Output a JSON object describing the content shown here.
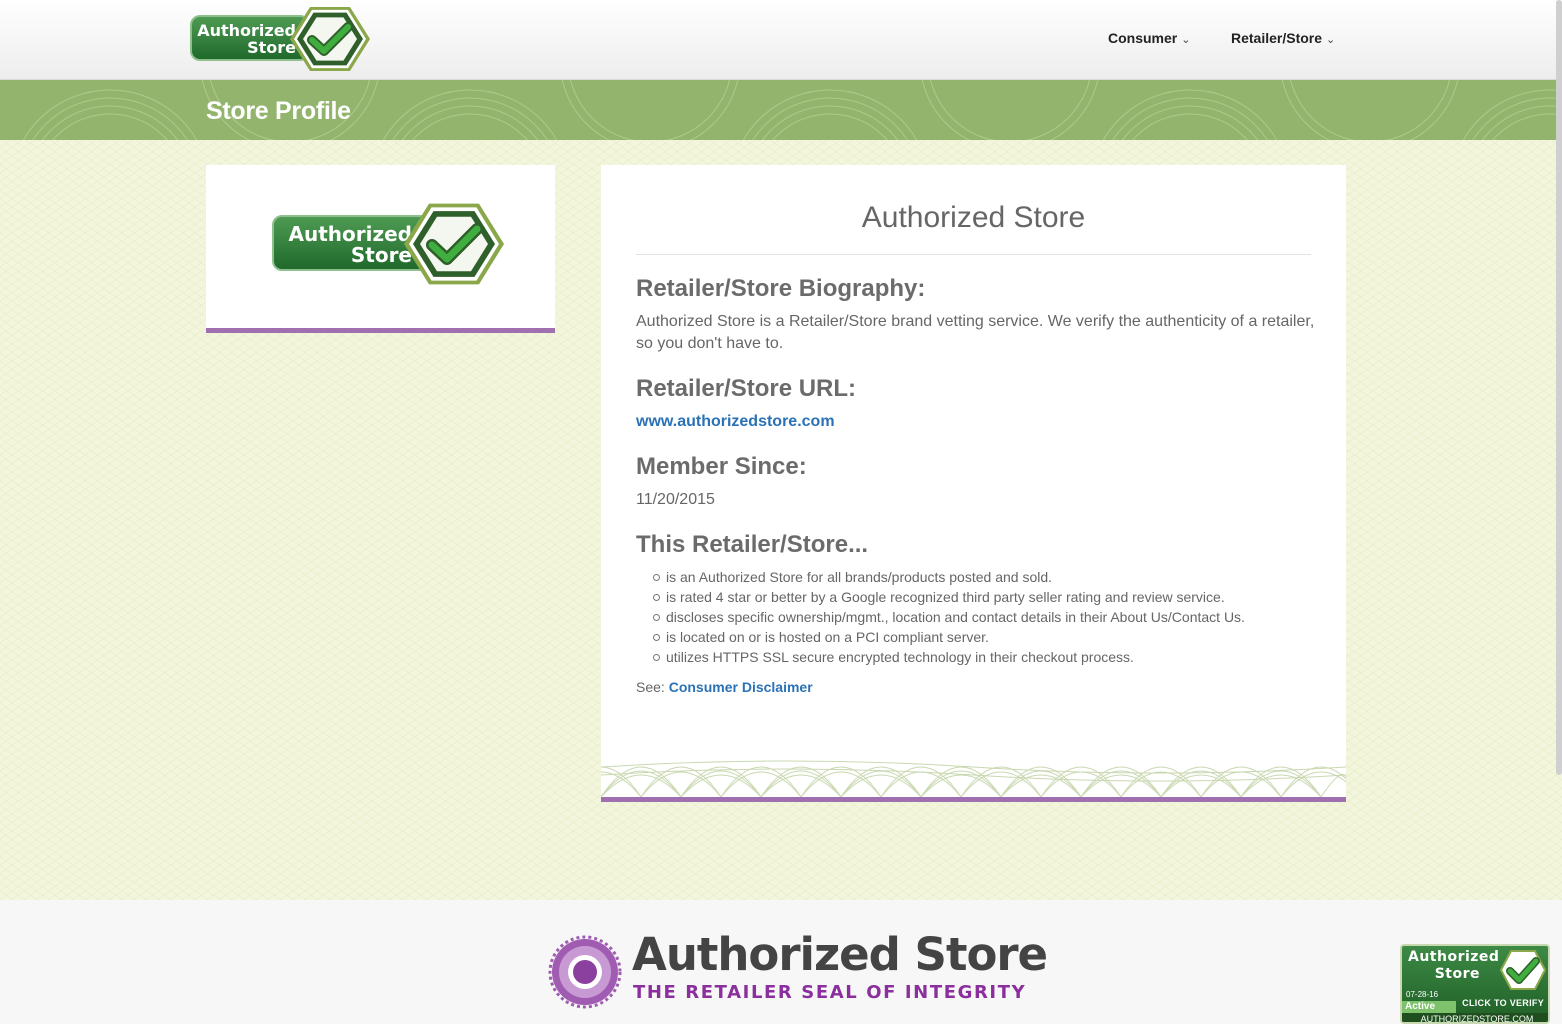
{
  "header": {
    "logo": {
      "line1": "Authorized",
      "line2": "Store"
    },
    "nav": [
      {
        "label": "Consumer"
      },
      {
        "label": "Retailer/Store"
      }
    ]
  },
  "band": {
    "title": "Store Profile"
  },
  "profile": {
    "logo": {
      "line1": "Authorized",
      "line2": "Store"
    },
    "store_name": "Authorized Store",
    "bio_heading": "Retailer/Store Biography:",
    "bio_text": "Authorized Store is a Retailer/Store brand vetting service. We verify the authenticity of a retailer, so you don't have to.",
    "url_heading": "Retailer/Store URL:",
    "url": "www.authorizedstore.com",
    "member_heading": "Member Since:",
    "member_date": "11/20/2015",
    "criteria_heading": "This Retailer/Store...",
    "criteria": [
      "is an Authorized Store for all brands/products posted and sold.",
      "is rated 4 star or better by a Google recognized third party seller rating and review service.",
      "discloses specific ownership/mgmt., location and contact details in their About Us/Contact Us.",
      "is located on or is hosted on a PCI compliant server.",
      "utilizes HTTPS SSL secure encrypted technology in their checkout process."
    ],
    "see_label": "See:",
    "disclaimer_link": "Consumer Disclaimer"
  },
  "footer": {
    "brand_name": "Authorized Store",
    "tagline": "THE RETAILER SEAL OF INTEGRITY"
  },
  "verify_badge": {
    "title_line1": "Authorized",
    "title_line2": "Store",
    "date": "07-28-16",
    "status": "Active",
    "cta": "CLICK TO VERIFY",
    "url": "AUTHORIZEDSTORE.COM"
  },
  "colors": {
    "accent_purple": "#a06fb0",
    "band_green": "#92b46c",
    "link_blue": "#2a72b5",
    "brand_purple": "#8b2f9e"
  },
  "icons": [
    "checkmark-icon",
    "chevron-down-icon",
    "seal-icon"
  ]
}
